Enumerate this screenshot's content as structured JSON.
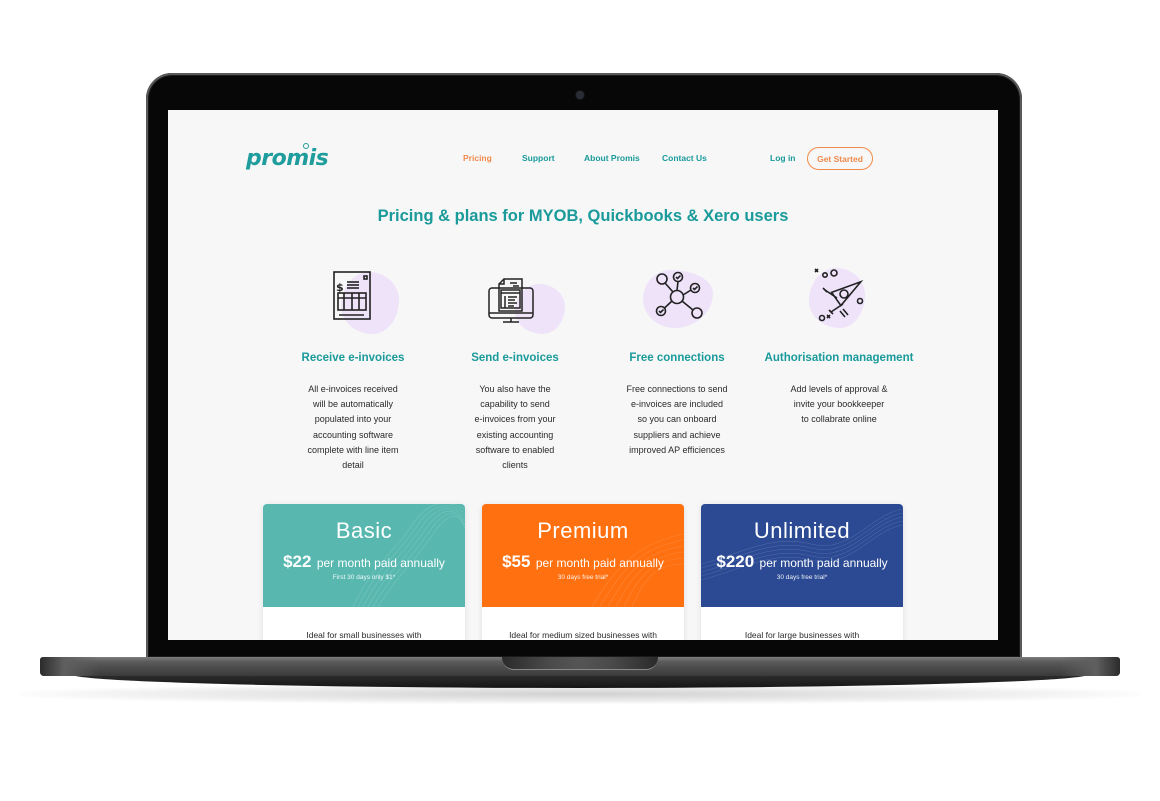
{
  "nav": {
    "logo": "promis",
    "links": [
      {
        "label": "Pricing",
        "active": true
      },
      {
        "label": "Support",
        "active": false
      },
      {
        "label": "About Promis",
        "active": false
      },
      {
        "label": "Contact Us",
        "active": false
      }
    ],
    "login_label": "Log in",
    "cta_label": "Get Started"
  },
  "page_title": "Pricing & plans for MYOB, Quickbooks & Xero users",
  "features": [
    {
      "icon": "invoice-document-icon",
      "title": "Receive e-invoices",
      "text": "All e-invoices received\nwill be automatically\npopulated into your\naccounting software\ncomplete with line item\ndetail"
    },
    {
      "icon": "monitor-invoice-icon",
      "title": "Send e-invoices",
      "text": "You also have the\ncapability to send\ne-invoices from your\nexisting accounting\nsoftware to enabled\nclients"
    },
    {
      "icon": "network-nodes-icon",
      "title": "Free connections",
      "text": "Free connections to send\ne-invoices are included\nso you can onboard\nsuppliers and achieve\nimproved AP efficiences"
    },
    {
      "icon": "rocket-icon",
      "title": "Authorisation management",
      "text": "Add levels of approval &\ninvite your bookkeeper\nto collabrate online"
    }
  ],
  "plans": [
    {
      "name": "Basic",
      "price": "$22",
      "period": "per month paid annually",
      "note": "First 30 days only $1*",
      "description": "Ideal for small businesses with",
      "color": "#58b8b0"
    },
    {
      "name": "Premium",
      "price": "$55",
      "period": "per month paid annually",
      "note": "30 days free trial*",
      "description": "Ideal for medium sized businesses with",
      "color": "#ff7010"
    },
    {
      "name": "Unlimited",
      "price": "$220",
      "period": "per month paid annually",
      "note": "30 days free trial*",
      "description": "Ideal for large businesses with",
      "color": "#2b4a93"
    }
  ],
  "colors": {
    "brand_teal": "#1a9a9a",
    "accent_orange": "#f08a4b",
    "screen_bg": "#f7f7f7",
    "icon_blob": "#efe3fa"
  }
}
